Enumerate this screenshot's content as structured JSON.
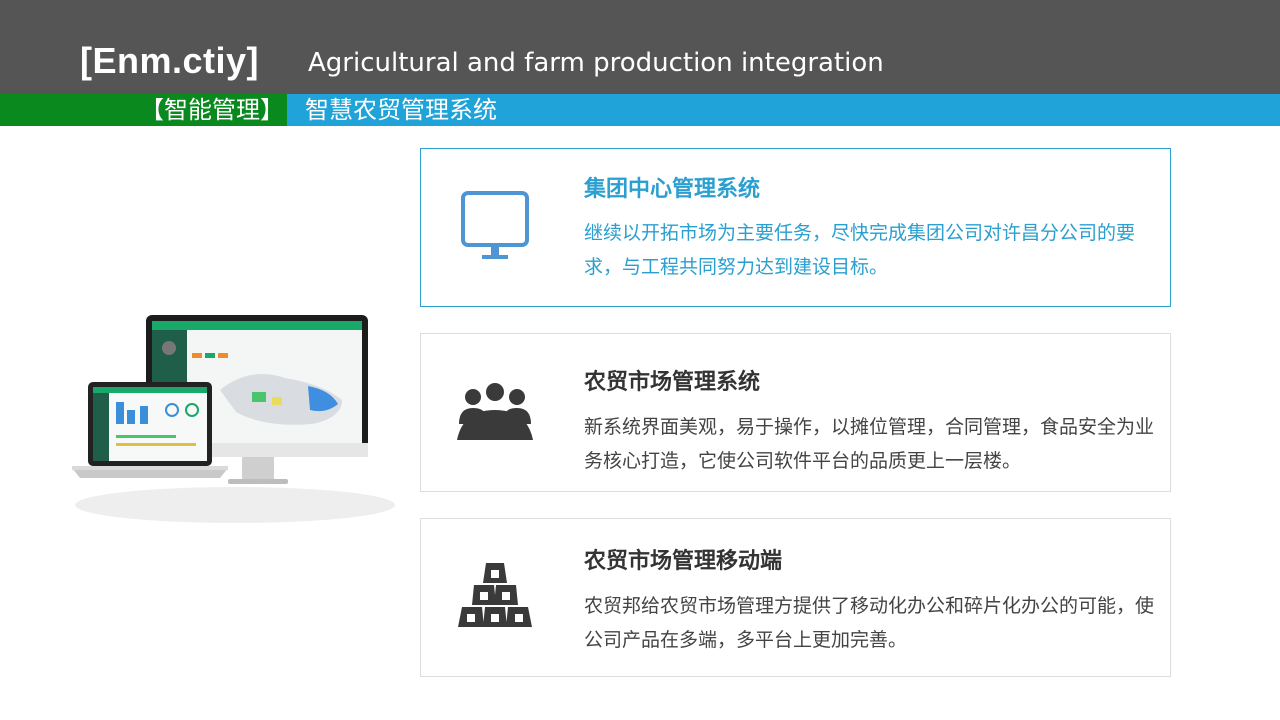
{
  "header": {
    "brand": "[Enm.ctiy]",
    "tagline": "Agricultural and farm production integration"
  },
  "subheader": {
    "tag": "【智能管理】",
    "title": "智慧农贸管理系统"
  },
  "cards": [
    {
      "icon": "monitor-icon",
      "title": "集团中心管理系统",
      "desc": "继续以开拓市场为主要任务，尽快完成集团公司对许昌分公司的要求，与工程共同努力达到建设目标。"
    },
    {
      "icon": "group-icon",
      "title": "农贸市场管理系统",
      "desc": "新系统界面美观，易于操作，以摊位管理，合同管理，食品安全为业务核心打造，它使公司软件平台的品质更上一层楼。"
    },
    {
      "icon": "stacked-bars-icon",
      "title": "农贸市场管理移动端",
      "desc": "农贸邦给农贸市场管理方提供了移动化办公和碎片化办公的可能，使公司产品在多端，多平台上更加完善。"
    }
  ],
  "colors": {
    "topbar": "#555555",
    "green": "#0a8a1e",
    "blue": "#1fa3d8",
    "accent": "#2a9fd0",
    "icon_dark": "#3a3a3a"
  }
}
